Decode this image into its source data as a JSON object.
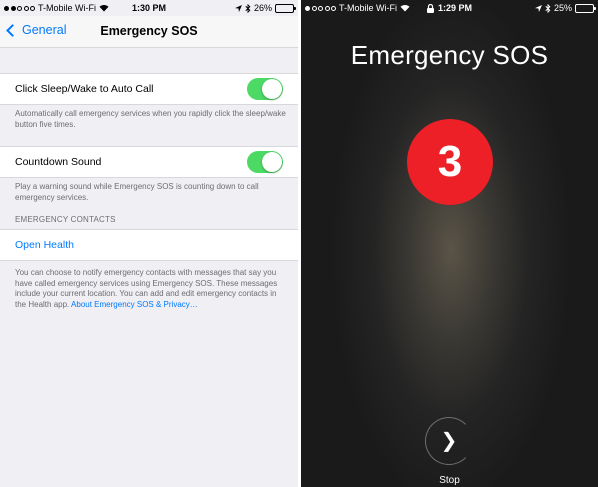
{
  "left": {
    "statusbar": {
      "carrier": "T-Mobile Wi-Fi",
      "time": "1:30 PM",
      "battery": "26%",
      "battery_fill": 0.26
    },
    "navbar": {
      "back_label": "General",
      "title": "Emergency SOS"
    },
    "auto_call": {
      "label": "Click Sleep/Wake to Auto Call",
      "enabled": true,
      "footnote": "Automatically call emergency services when you rapidly click the sleep/wake button five times."
    },
    "countdown_sound": {
      "label": "Countdown Sound",
      "enabled": true,
      "footnote": "Play a warning sound while Emergency SOS is counting down to call emergency services."
    },
    "emergency_contacts": {
      "header": "EMERGENCY CONTACTS",
      "open_health": "Open Health",
      "footnote": "You can choose to notify emergency contacts with messages that say you have called emergency services using Emergency SOS. These messages include your current location. You can add and edit emergency contacts in the Health app.",
      "about_link": "About Emergency SOS & Privacy…"
    }
  },
  "right": {
    "statusbar": {
      "carrier": "T-Mobile Wi-Fi",
      "time": "1:29 PM",
      "battery": "25%",
      "battery_fill": 0.25
    },
    "title": "Emergency SOS",
    "countdown": "3",
    "stop_label": "Stop"
  },
  "colors": {
    "accent": "#007aff",
    "toggle_on": "#4cd964",
    "sos_red": "#ee2027",
    "battery_low": "#f5c400"
  },
  "icons": [
    "signal-dots-icon",
    "wifi-icon",
    "bluetooth-icon",
    "location-arrow-icon",
    "lock-icon",
    "battery-icon",
    "chevron-left-icon",
    "arrow-right-icon"
  ]
}
